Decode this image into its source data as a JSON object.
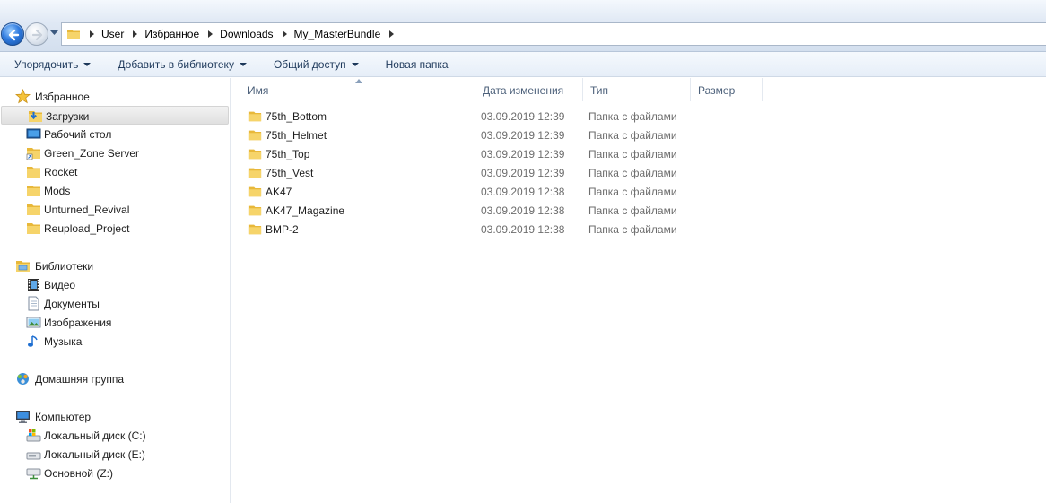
{
  "breadcrumb": [
    "User",
    "Избранное",
    "Downloads",
    "My_MasterBundle"
  ],
  "toolbar": {
    "organize": "Упорядочить",
    "add_to_library": "Добавить в библиотеку",
    "share": "Общий доступ",
    "new_folder": "Новая папка"
  },
  "sidebar": {
    "favorites": {
      "label": "Избранное",
      "items": [
        {
          "label": "Загрузки",
          "icon": "downloads-folder-icon",
          "selected": true
        },
        {
          "label": "Рабочий стол",
          "icon": "desktop-icon"
        },
        {
          "label": "Green_Zone Server",
          "icon": "folder-shortcut-icon"
        },
        {
          "label": "Rocket",
          "icon": "folder-icon"
        },
        {
          "label": "Mods",
          "icon": "folder-icon"
        },
        {
          "label": "Unturned_Revival",
          "icon": "folder-icon"
        },
        {
          "label": "Reupload_Project",
          "icon": "folder-icon"
        }
      ]
    },
    "libraries": {
      "label": "Библиотеки",
      "items": [
        {
          "label": "Видео",
          "icon": "video-icon"
        },
        {
          "label": "Документы",
          "icon": "documents-icon"
        },
        {
          "label": "Изображения",
          "icon": "pictures-icon"
        },
        {
          "label": "Музыка",
          "icon": "music-icon"
        }
      ]
    },
    "homegroup": {
      "label": "Домашняя группа"
    },
    "computer": {
      "label": "Компьютер",
      "items": [
        {
          "label": "Локальный диск (C:)",
          "icon": "system-drive-icon"
        },
        {
          "label": "Локальный диск (E:)",
          "icon": "drive-icon"
        },
        {
          "label": "Основной (Z:)",
          "icon": "network-drive-icon"
        }
      ]
    }
  },
  "columns": {
    "name": "Имя",
    "date": "Дата изменения",
    "type": "Тип",
    "size": "Размер"
  },
  "files": [
    {
      "name": "75th_Bottom",
      "date": "03.09.2019 12:39",
      "type": "Папка с файлами",
      "size": ""
    },
    {
      "name": "75th_Helmet",
      "date": "03.09.2019 12:39",
      "type": "Папка с файлами",
      "size": ""
    },
    {
      "name": "75th_Top",
      "date": "03.09.2019 12:39",
      "type": "Папка с файлами",
      "size": ""
    },
    {
      "name": "75th_Vest",
      "date": "03.09.2019 12:39",
      "type": "Папка с файлами",
      "size": ""
    },
    {
      "name": "AK47",
      "date": "03.09.2019 12:38",
      "type": "Папка с файлами",
      "size": ""
    },
    {
      "name": "AK47_Magazine",
      "date": "03.09.2019 12:38",
      "type": "Папка с файлами",
      "size": ""
    },
    {
      "name": "BMP-2",
      "date": "03.09.2019 12:38",
      "type": "Папка с файлами",
      "size": ""
    }
  ],
  "colors": {
    "accent": "#1e395b",
    "folder": "#f2c94c",
    "selection": "#e5e5e5"
  }
}
